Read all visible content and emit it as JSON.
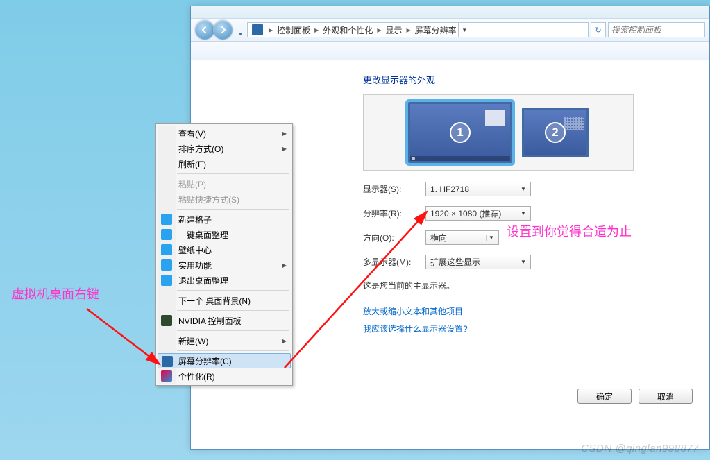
{
  "breadcrumb": {
    "items": [
      "控制面板",
      "外观和个性化",
      "显示",
      "屏幕分辨率"
    ]
  },
  "search": {
    "placeholder": "搜索控制面板"
  },
  "heading": "更改显示器的外观",
  "monitors": {
    "active": 1,
    "secondary": 2
  },
  "fields": {
    "display_label": "显示器(S):",
    "display_value": "1. HF2718",
    "resolution_label": "分辨率(R):",
    "resolution_value": "1920 × 1080 (推荐)",
    "orientation_label": "方向(O):",
    "orientation_value": "横向",
    "multi_label": "多显示器(M):",
    "multi_value": "扩展这些显示"
  },
  "current_note": "这是您当前的主显示器。",
  "link_scale": "放大或缩小文本和其他项目",
  "link_which": "我应该选择什么显示器设置?",
  "btn_ok": "确定",
  "btn_cancel": "取消",
  "context_menu": {
    "view": "查看(V)",
    "sort": "排序方式(O)",
    "refresh": "刷新(E)",
    "paste": "粘贴(P)",
    "paste_shortcut": "粘贴快捷方式(S)",
    "new_grid": "新建格子",
    "one_key": "一键桌面整理",
    "wallpaper": "壁纸中心",
    "utility": "实用功能",
    "exit_tidy": "退出桌面整理",
    "next_bg": "下一个 桌面背景(N)",
    "nvidia": "NVIDIA 控制面板",
    "new": "新建(W)",
    "screen_res": "屏幕分辨率(C)",
    "personalize": "个性化(R)"
  },
  "annotations": {
    "vm_right_click": "虚拟机桌面右键",
    "adjust_until": "设置到你觉得合适为止"
  },
  "watermark": "CSDN @qinglan998877"
}
